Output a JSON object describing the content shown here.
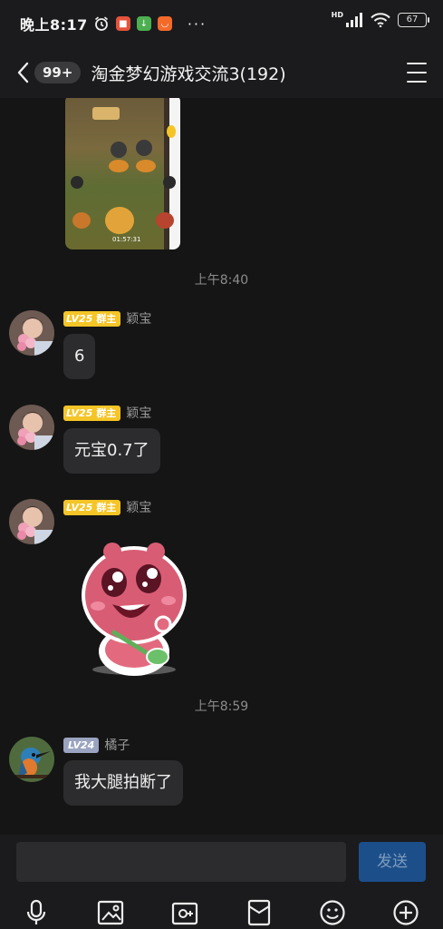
{
  "status": {
    "time": "晚上8:17",
    "network": "HD",
    "battery": "67",
    "more": "···"
  },
  "header": {
    "unread": "99+",
    "title": "淘金梦幻游戏交流3(192)"
  },
  "game_image": {
    "timer": "01:57:31"
  },
  "timestamps": [
    "上午8:40",
    "上午8:59"
  ],
  "messages": [
    {
      "level": "LV25",
      "role": "群主",
      "nick": "颖宝",
      "text": "6"
    },
    {
      "level": "LV25",
      "role": "群主",
      "nick": "颖宝",
      "text": "元宝0.7了"
    },
    {
      "level": "LV25",
      "role": "群主",
      "nick": "颖宝",
      "sticker": "pink-bear-sticker"
    },
    {
      "level": "LV24",
      "role": "",
      "nick": "橘子",
      "text": "我大腿拍断了"
    }
  ],
  "composer": {
    "placeholder": "",
    "send_label": "发送"
  },
  "toolbar": [
    "mic-icon",
    "image-icon",
    "camera-icon",
    "red-packet-icon",
    "emoji-icon",
    "plus-icon"
  ],
  "colors": {
    "background": "#151515",
    "bubble": "#2c2c2e",
    "owner_badge": "#f5c527",
    "level_badge": "#9aa4c0",
    "send_button": "#1c4f8a"
  }
}
